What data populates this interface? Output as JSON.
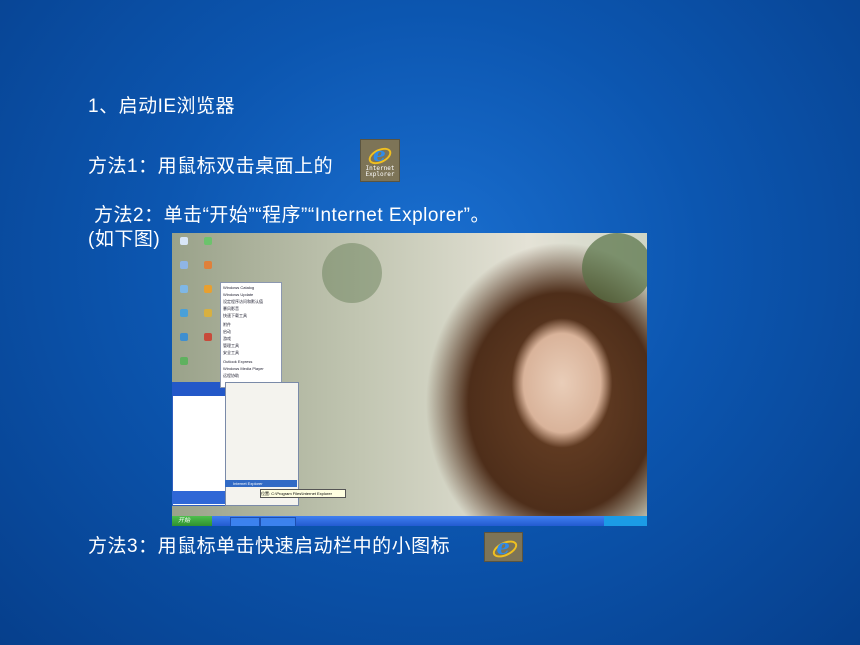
{
  "slide": {
    "title": "1、启动IE浏览器",
    "method1": "方法1：用鼠标双击桌面上的",
    "method2_line1": "方法2：单击“开始”“程序”“Internet Explorer”。",
    "method2_line2": "(如下图)",
    "method3": "方法3：用鼠标单击快速启动栏中的小图标"
  },
  "desktop_icon": {
    "name": "ie-icon",
    "caption_line1": "Internet",
    "caption_line2": "Explorer"
  },
  "screenshot": {
    "start_button": "开始",
    "highlighted_item": "Internet Explorer",
    "tooltip": "位置: C:\\Program Files\\Internet Explorer",
    "programs_menu_items": [
      "Windows Catalog",
      "Windows Update",
      "设定程序访问和默认值",
      "暴风影音",
      "快速下载工具",
      "附件",
      "启动",
      "游戏",
      "管理工具",
      "安全工具",
      "Outlook Express",
      "Windows Media Player",
      "远程协助"
    ]
  },
  "colors": {
    "background": "#0c56b0",
    "text": "#ffffff",
    "ie_blue": "#2f8bea",
    "xp_taskbar": "#235bd0",
    "xp_start": "#2f912f"
  }
}
